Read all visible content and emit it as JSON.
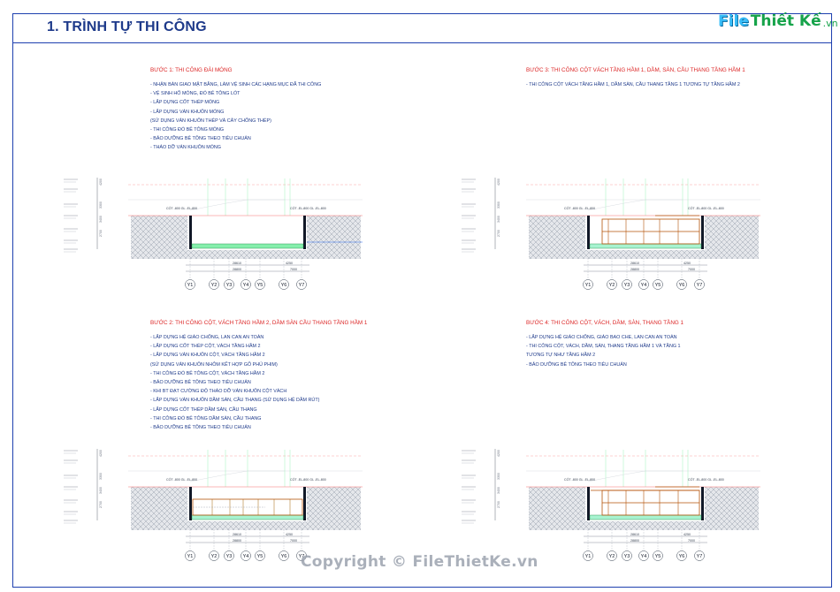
{
  "title": "1. TRÌNH TỰ THI CÔNG",
  "logo": {
    "file": "File",
    "thiet": "Thiết Kế",
    "vn": ".vn"
  },
  "steps": [
    {
      "heading": "BƯỚC 1: THI CÔNG ĐÀI MÓNG",
      "lines": [
        "- NHẬN BÀN GIAO MẶT BẰNG, LÀM VỆ SINH CÁC HẠNG MỤC ĐÃ THI CÔNG",
        "- VỆ SINH HỐ MÓNG, ĐỔ BÊ TÔNG LÓT",
        "- LẮP DỰNG CỐT THÉP MÓNG",
        "- LẮP DỰNG VÁN KHUÔN MÓNG",
        "(SỬ DỤNG VÁN KHUÔN THÉP VÀ CÂY CHỐNG THÉP)",
        "- THI CÔNG ĐỔ BÊ TÔNG MÓNG",
        "- BẢO DƯỠNG BÊ TÔNG THEO TIÊU CHUẨN",
        "- THÁO DỠ VÁN KHUÔN MÓNG"
      ]
    },
    {
      "heading": "BƯỚC 3: THI CÔNG CỘT VÁCH TẦNG HẦM 1, DẦM, SÀN, CẦU THANG TẦNG HẦM 1",
      "lines": [
        "- THI CÔNG CỘT VÁCH TẦNG HẦM 1, DẦM SÀN, CẦU THANG TẦNG 1 TƯƠNG TỰ TẦNG HẦM 2"
      ]
    },
    {
      "heading": "BƯỚC 2: THI CÔNG CỘT, VÁCH TẦNG HẦM 2, DẦM SÀN CẦU THANG TẦNG HẦM 1",
      "lines": [
        "- LẮP DỰNG HỆ GIÁO CHỐNG, LAN CAN AN TOÀN",
        "- LẮP DỰNG CỐT THÉP CỘT, VÁCH TẦNG HẦM 2",
        "- LẮP DỰNG VÁN KHUÔN CỘT, VÁCH TẦNG HẦM 2",
        "(SỬ DỤNG VÁN KHUÔN NHÔM KẾT HỢP GỖ PHỦ PHIM)",
        "- THI CÔNG ĐỔ BÊ TÔNG CỘT, VÁCH TẦNG HẦM 2",
        "- BẢO DƯỠNG BÊ TÔNG THEO TIÊU CHUẨN",
        "- KHI BT ĐẠT CƯỜNG ĐỘ THÁO DỠ VÁN KHUÔN CỘT VÁCH",
        "- LẮP DỰNG VÁN KHUÔN DẦM SÀN, CẦU THANG (SỬ DỤNG HỆ DẦM RÚT)",
        "- LẮP DỰNG CỐT THÉP DẦM SÀN, CẦU THANG",
        "- THI CÔNG ĐỔ BÊ TÔNG DẦM SÀN, CẦU THANG",
        "- BẢO DƯỠNG BÊ TÔNG THEO TIÊU CHUẨN"
      ]
    },
    {
      "heading": "BƯỚC 4: THI CÔNG CỘT, VÁCH, DẦM, SÀN, THANG TẦNG 1",
      "lines": [
        "- LẮP DỰNG HỆ GIÁO CHỐNG, GIÁO BAO CHE, LAN CAN AN TOÀN",
        "- THI CÔNG CỘT, VÁCH, DẦM, SÀN, THANG TẦNG HẦM 1 VÀ TẦNG 1",
        "TƯƠNG TỰ NHƯ TẦNG HẦM 2",
        "- BẢO DƯỠNG BÊ TÔNG THEO TIÊU CHUẨN"
      ]
    }
  ],
  "section": {
    "grid_labels": [
      "Y1",
      "Y2",
      "Y3",
      "Y4",
      "Y5",
      "Y6",
      "Y7"
    ],
    "dim_top": [
      "28610",
      "4250"
    ],
    "dim_bottom": [
      "28800",
      "7000"
    ],
    "column_left": [
      "CỐT -800",
      "GL -EL-800"
    ],
    "column_right": [
      "CỐT -EL-800",
      "GL -EL-800"
    ],
    "vertical_dims": [
      "4200",
      "3300",
      "3400",
      "2700"
    ]
  },
  "watermark": "Copyright © FileThietKe.vn"
}
